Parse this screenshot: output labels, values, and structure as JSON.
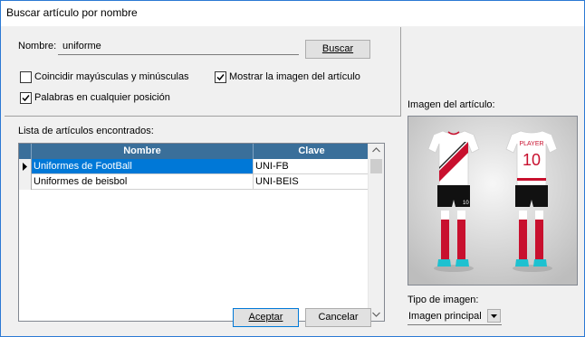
{
  "window": {
    "title": "Buscar artículo por nombre"
  },
  "search": {
    "name_label": "Nombre:",
    "name_value": "uniforme",
    "search_button": "Buscar"
  },
  "options": {
    "match_case": {
      "label": "Coincidir mayúsculas y minúsculas",
      "checked": false
    },
    "words_any_position": {
      "label": "Palabras en cualquier posición",
      "checked": true
    },
    "show_image": {
      "label": "Mostrar la imagen del artículo",
      "checked": true
    }
  },
  "results": {
    "label": "Lista de artículos encontrados:",
    "columns": [
      "Nombre",
      "Clave"
    ],
    "rows": [
      {
        "nombre": "Uniformes de FootBall",
        "clave": "UNI-FB",
        "selected": true
      },
      {
        "nombre": "Uniformes de beisbol",
        "clave": "UNI-BEIS",
        "selected": false
      }
    ]
  },
  "image_panel": {
    "label": "Imagen del artículo:",
    "type_label": "Tipo de imagen:",
    "type_value": "Imagen principal",
    "kit": {
      "player_name": "PLAYER",
      "back_number": "10",
      "short_number": "10"
    }
  },
  "footer": {
    "accept_button": "Aceptar",
    "cancel_button": "Cancelar"
  },
  "colors": {
    "header_bg": "#3a6f9a",
    "selection_bg": "#0078d7",
    "window_border": "#2b79d4",
    "kit_red": "#c8102e"
  }
}
